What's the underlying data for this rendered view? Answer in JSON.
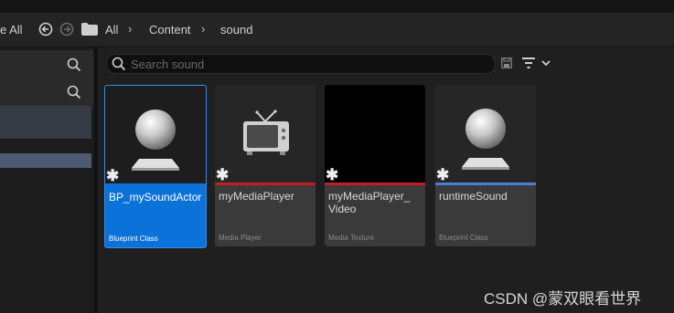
{
  "toolbar": {
    "save_all": "e All",
    "breadcrumbs": [
      "All",
      "Content",
      "sound"
    ]
  },
  "search": {
    "placeholder": "Search sound",
    "value": ""
  },
  "assets": [
    {
      "name": "BP_mySoundActor",
      "type": "Blueprint Class",
      "color": "#0a72d9",
      "icon": "sphere-icon",
      "selected": true
    },
    {
      "name": "myMediaPlayer",
      "type": "Media Player",
      "color": "#c41e1e",
      "icon": "tv-icon",
      "selected": false
    },
    {
      "name": "myMediaPlayer_ Video",
      "type": "Media Texture",
      "color": "#c41e1e",
      "icon": "black-texture",
      "selected": false
    },
    {
      "name": "runtimeSound",
      "type": "Blueprint Class",
      "color": "#4a7dd6",
      "icon": "sphere-icon",
      "selected": false
    }
  ],
  "watermark": "CSDN @蒙双眼看世界"
}
